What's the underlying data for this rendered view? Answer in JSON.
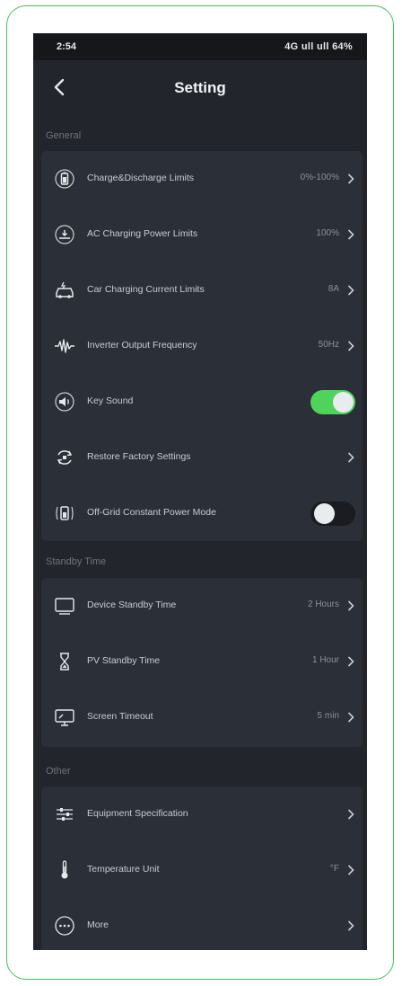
{
  "status": {
    "time": "2:54",
    "indicators": "4G ull ull 64%"
  },
  "header": {
    "title": "Setting"
  },
  "sections": {
    "general": {
      "label": "General",
      "items": [
        {
          "label": "Charge&Discharge Limits",
          "value": "0%-100%"
        },
        {
          "label": "AC Charging Power Limits",
          "value": "100%"
        },
        {
          "label": "Car Charging Current Limits",
          "value": "8A"
        },
        {
          "label": "Inverter Output Frequency",
          "value": "50Hz"
        },
        {
          "label": "Key Sound",
          "toggle": true
        },
        {
          "label": "Restore Factory Settings",
          "value": ""
        },
        {
          "label": "Off-Grid Constant Power Mode",
          "toggle": false
        }
      ]
    },
    "standby": {
      "label": "Standby Time",
      "items": [
        {
          "label": "Device Standby Time",
          "value": "2 Hours"
        },
        {
          "label": "PV Standby Time",
          "value": "1 Hour"
        },
        {
          "label": "Screen Timeout",
          "value": "5 min"
        }
      ]
    },
    "other": {
      "label": "Other",
      "items": [
        {
          "label": "Equipment Specification",
          "value": ""
        },
        {
          "label": "Temperature Unit",
          "value": "°F"
        },
        {
          "label": "More",
          "value": ""
        }
      ]
    }
  },
  "colors": {
    "accent": "#4fd35b",
    "background": "#22252c",
    "card": "#2b2f37",
    "frame": "#3cc35a"
  }
}
